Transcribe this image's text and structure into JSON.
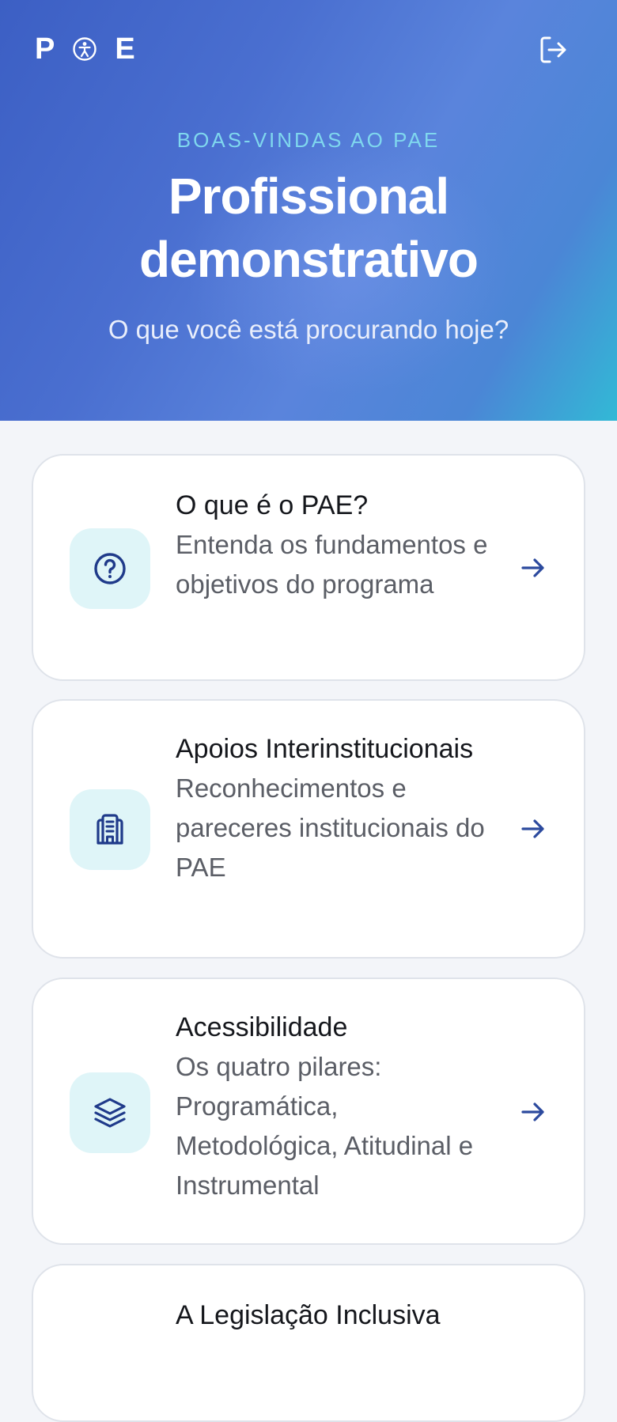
{
  "header": {
    "logo_letters": [
      "P",
      "E"
    ],
    "logo_icon": "accessibility-person-icon",
    "logout_icon": "logout-icon",
    "eyebrow": "BOAS-VINDAS AO PAE",
    "title_line1": "Profissional",
    "title_line2": "demonstrativo",
    "subtitle": "O que você está procurando hoje?"
  },
  "colors": {
    "hero_start": "#3c5fc4",
    "hero_end": "#32b9d6",
    "eyebrow": "#7fd7ee",
    "icon_bg": "#dff5f8",
    "icon_ink": "#1f3a8a",
    "arrow": "#2c4a9e"
  },
  "cards": [
    {
      "icon": "question-circle-icon",
      "title": "O que é o PAE?",
      "desc": "Entenda os fundamentos e objetivos do programa",
      "arrow_icon": "arrow-right-icon"
    },
    {
      "icon": "building-icon",
      "title": "Apoios Interinstitucionais",
      "desc": "Reconhecimentos e pareceres institucionais do PAE",
      "arrow_icon": "arrow-right-icon"
    },
    {
      "icon": "layers-icon",
      "title": "Acessibilidade",
      "desc": "Os quatro pilares: Programática, Metodológica, Atitudinal e Instrumental",
      "arrow_icon": "arrow-right-icon"
    },
    {
      "title": "A Legislação Inclusiva"
    }
  ]
}
